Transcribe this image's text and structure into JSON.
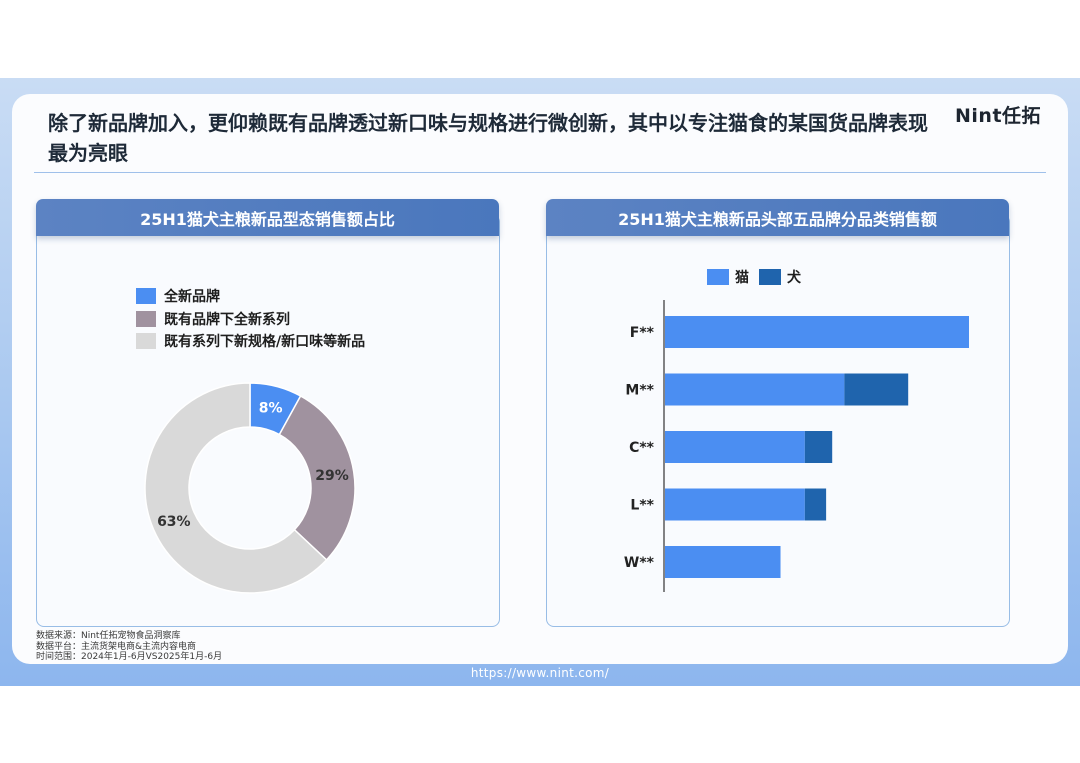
{
  "headline": "除了新品牌加入，更仰赖既有品牌透过新口味与规格进行微创新，其中以专注猫食的某国货品牌表现最为亮眼",
  "logo": "Nint任拓",
  "left_panel": {
    "title": "25H1猫犬主粮新品型态销售额占比"
  },
  "right_panel": {
    "title": "25H1猫犬主粮新品头部五品牌分品类销售额"
  },
  "colors": {
    "blue": "#4b8ef2",
    "mauve": "#a0929f",
    "gray": "#d9d9d9",
    "cat": "#4b8ef2",
    "dog": "#1f64ad"
  },
  "chart_data": [
    {
      "type": "pie",
      "donut": true,
      "title": "25H1猫犬主粮新品型态销售额占比",
      "legend": "top-left",
      "slices": [
        {
          "label": "全新品牌",
          "value": 8,
          "display": "8%",
          "color": "#4b8ef2"
        },
        {
          "label": "既有品牌下全新系列",
          "value": 29,
          "display": "29%",
          "color": "#a0929f"
        },
        {
          "label": "既有系列下新规格/新口味等新品",
          "value": 63,
          "display": "63%",
          "color": "#d9d9d9"
        }
      ]
    },
    {
      "type": "bar",
      "orientation": "horizontal",
      "stacked": true,
      "title": "25H1猫犬主粮新品头部五品牌分品类销售额",
      "legend": "top",
      "categories": [
        "F**",
        "M**",
        "C**",
        "L**",
        "W**"
      ],
      "xlim": [
        0,
        100
      ],
      "series": [
        {
          "name": "猫",
          "color": "#4b8ef2",
          "values": [
            100,
            59,
            46,
            46,
            38
          ]
        },
        {
          "name": "犬",
          "color": "#1f64ad",
          "values": [
            0,
            21,
            9,
            7,
            0
          ]
        }
      ]
    }
  ],
  "footnote": {
    "source": "数据来源：Nint任拓宠物食品洞察库",
    "platform": "数据平台：主流货架电商&主流内容电商",
    "period": "时间范围：2024年1月-6月VS2025年1月-6月"
  },
  "url": "https://www.nint.com/"
}
